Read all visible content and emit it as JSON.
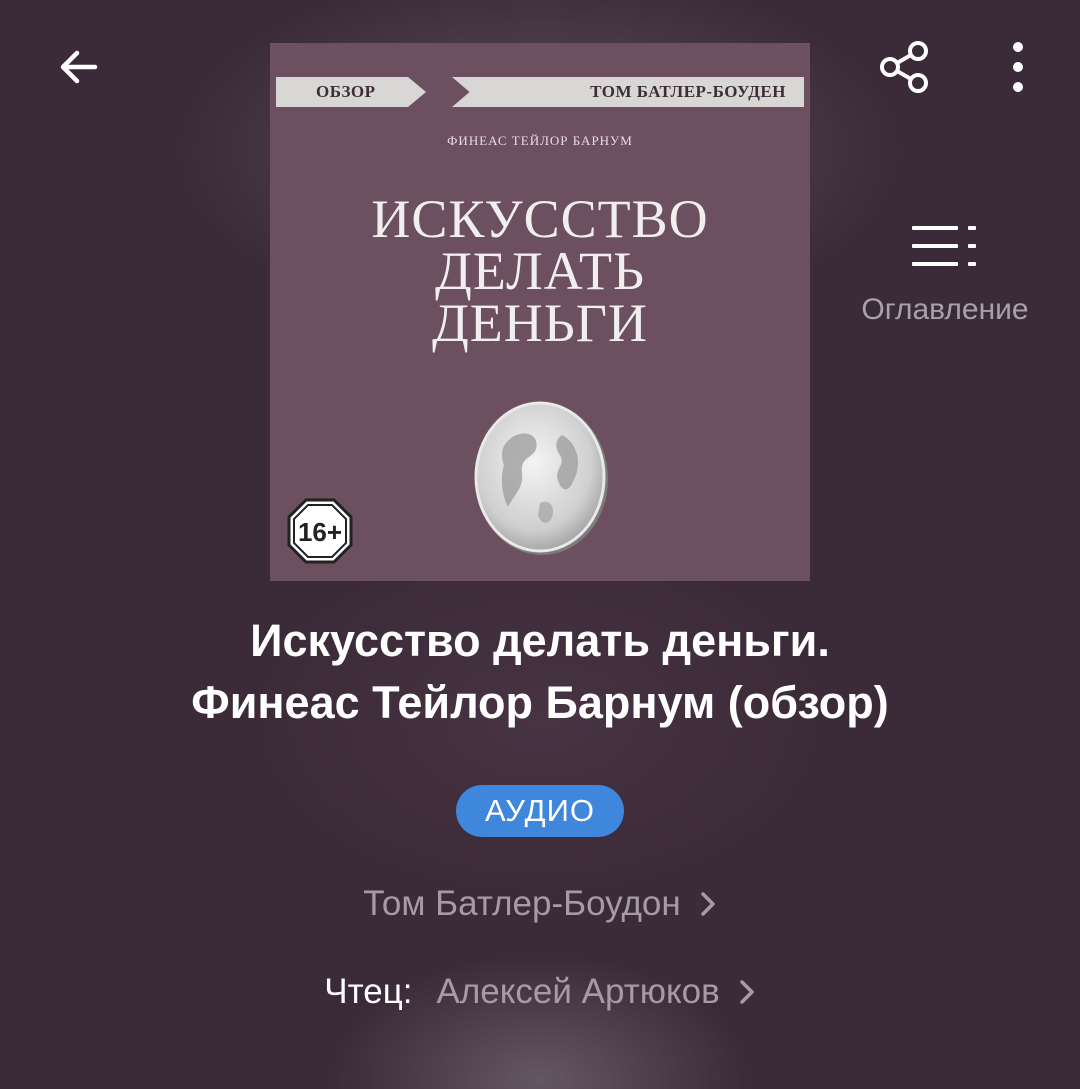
{
  "toolbar": {
    "back_icon": "arrow-left-icon",
    "share_icon": "share-icon",
    "more_icon": "more-vertical-icon"
  },
  "toc": {
    "icon": "list-icon",
    "label": "Оглавление"
  },
  "cover": {
    "ribbon_left": "ОБЗОР",
    "ribbon_right": "ТОМ БАТЛЕР-БОУДЕН",
    "author": "ФИНЕАС ТЕЙЛОР БАРНУМ",
    "title_lines": [
      "ИСКУССТВО",
      "ДЕЛАТЬ",
      "ДЕНЬГИ"
    ],
    "age_rating": "16+",
    "background_color": "#6c5060"
  },
  "book": {
    "title_line1": "Искусство делать деньги.",
    "title_line2": "Финеас Тейлор Барнум (обзор)",
    "format": "АУДИО",
    "author": "Том Батлер-Боудон",
    "narrator_label": "Чтец:",
    "narrator": "Алексей Артюков"
  },
  "colors": {
    "background": "#3b2a37",
    "badge": "#3f86dd",
    "muted_text": "#a69aa3"
  }
}
